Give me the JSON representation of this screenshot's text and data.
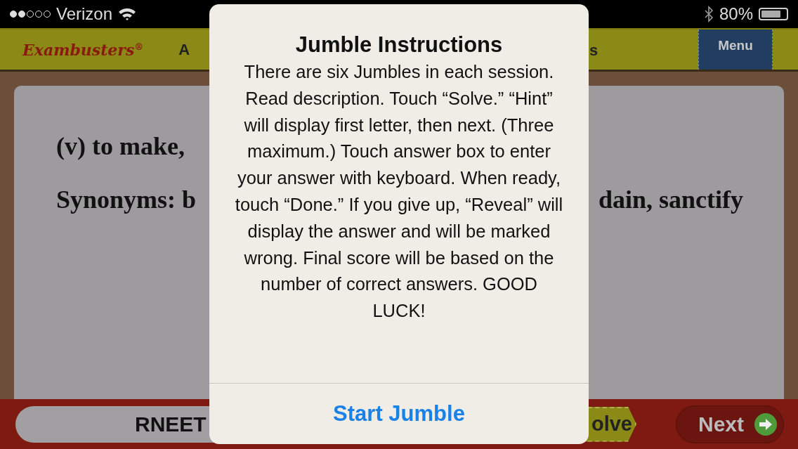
{
  "status_bar": {
    "signal_dots": [
      {
        "filled": true
      },
      {
        "filled": true
      },
      {
        "filled": false
      },
      {
        "filled": false
      },
      {
        "filled": false
      }
    ],
    "carrier": "Verizon",
    "battery_text": "80%",
    "battery": {
      "level": 0.8
    }
  },
  "header": {
    "logo": "Exambusters",
    "logo_mark": "®",
    "title_left_fragment": "A",
    "title_right_fragment": "s",
    "menu": "Menu"
  },
  "card": {
    "definition": "(v) to make,",
    "synonyms_left": "Synonyms: b",
    "synonyms_right": "dain, sanctify"
  },
  "bottom_bar": {
    "answer": "RNEET",
    "solve": "olve",
    "next": "Next"
  },
  "alert": {
    "title": "Jumble Instructions",
    "message": "There are six Jumbles in each session. Read description. Touch “Solve.” “Hint” will display first letter, then next. (Three maximum.) Touch answer box to enter your answer with keyboard. When ready, touch “Done.” If you give up, “Reveal” will display the answer and will be marked wrong. Final score will be based on the number of correct answers. GOOD LUCK!",
    "button": "Start Jumble"
  }
}
